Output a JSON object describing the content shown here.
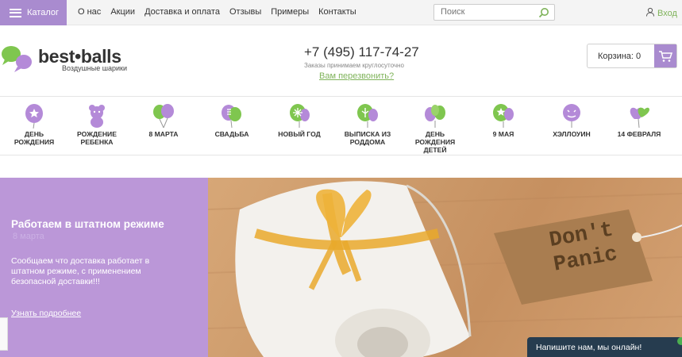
{
  "topbar": {
    "catalog_label": "Каталог",
    "nav": [
      "О нас",
      "Акции",
      "Доставка и оплата",
      "Отзывы",
      "Примеры",
      "Контакты"
    ],
    "search_placeholder": "Поиск",
    "login_label": "Вход"
  },
  "header": {
    "brand": "best•balls",
    "tagline": "Воздушные шарики",
    "phone": "+7 (495) 117-74-27",
    "phone_note": "Заказы принимаем круглосуточно",
    "callback": "Вам перезвонить?",
    "cart_label": "Корзина: 0"
  },
  "categories": [
    {
      "label": "День рождения",
      "icon": "balloon-star-icon"
    },
    {
      "label": "Рождение ребенка",
      "icon": "teddy-bear-icon"
    },
    {
      "label": "8 марта",
      "icon": "balloons-icon"
    },
    {
      "label": "Свадьба",
      "icon": "wedding-balloons-icon"
    },
    {
      "label": "Новый год",
      "icon": "snowflake-balloon-icon"
    },
    {
      "label": "Выписка из роддома",
      "icon": "stork-balloon-icon"
    },
    {
      "label": "День рождения детей",
      "icon": "kids-balloons-icon"
    },
    {
      "label": "9 мая",
      "icon": "star-balloon-icon"
    },
    {
      "label": "Хэллоуин",
      "icon": "pumpkin-balloon-icon"
    },
    {
      "label": "14 февраля",
      "icon": "heart-balloons-icon"
    }
  ],
  "promo": {
    "title": "Работаем в штатном режиме",
    "ghost": "8 марта",
    "text": "Сообщаем что доставка работает в штатном режиме, с применением безопасной доставки!!!",
    "link": "Узнать подробнее"
  },
  "photo": {
    "tag_text": "Don't Panic"
  },
  "chat_label": "Напишите нам, мы онлайн!",
  "colors": {
    "accent": "#a98bcf",
    "green": "#7fb35a",
    "promo_bg": "#bb97d8",
    "chat_bg": "#263c4f"
  }
}
